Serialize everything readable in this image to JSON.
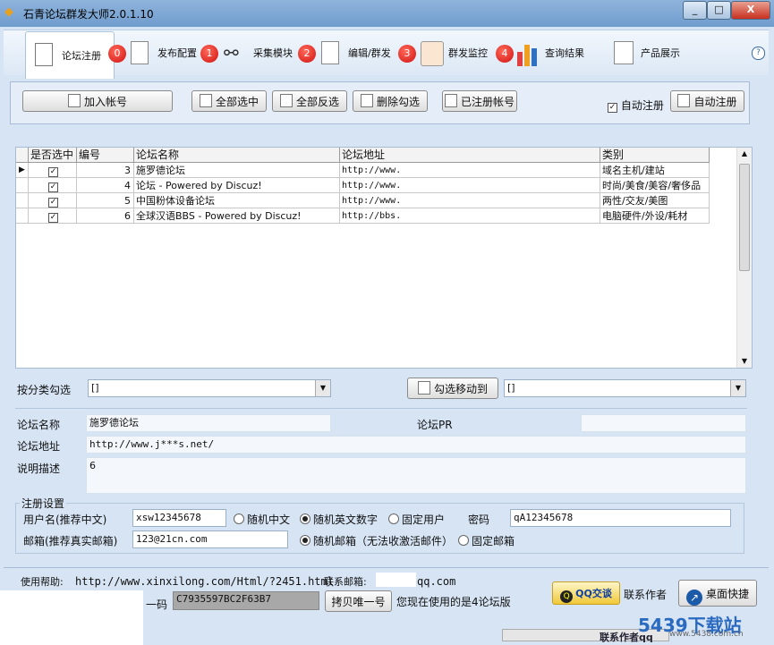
{
  "window": {
    "title": "石青论坛群发大师2.0.1.10",
    "min": "_",
    "max": "□",
    "close": "X"
  },
  "ribbon": {
    "tabs": [
      {
        "label": "论坛注册"
      },
      {
        "label": "发布配置",
        "badge": "0"
      },
      {
        "label": "采集模块",
        "badge": "1"
      },
      {
        "label": "编辑/群发",
        "badge": "2"
      },
      {
        "label": "群发监控",
        "badge": "3"
      },
      {
        "label": "查询结果",
        "badge": "4"
      },
      {
        "label": "产品展示"
      }
    ],
    "help": "?"
  },
  "toolbar": {
    "add_account": "加入帐号",
    "select_all": "全部选中",
    "invert": "全部反选",
    "delete_checked": "删除勾选",
    "registered": "已注册帐号",
    "auto_register_check": "自动注册",
    "auto_register_btn": "自动注册"
  },
  "grid": {
    "columns": [
      "是否选中",
      "编号",
      "论坛名称",
      "论坛地址",
      "类别"
    ],
    "rows": [
      {
        "num": "3",
        "name": "施罗德论坛",
        "url": "http://www.",
        "cat": "域名主机/建站"
      },
      {
        "num": "4",
        "name": "论坛 -  Powered by Discuz!",
        "url": "http://www.",
        "cat": "时尚/美食/美容/奢侈品"
      },
      {
        "num": "5",
        "name": "中国粉体设备论坛",
        "url": "http://www.",
        "cat": "两性/交友/美图"
      },
      {
        "num": "6",
        "name": " 全球汉语BBS  - Powered by Discuz!",
        "url": "http://bbs.",
        "cat": "电脑硬件/外设/耗材"
      }
    ]
  },
  "filter": {
    "label": "按分类勾选",
    "value": "[]",
    "move_btn": "勾选移动到",
    "move_value": "[]"
  },
  "detail": {
    "name_label": "论坛名称",
    "name": "施罗德论坛",
    "pr_label": "论坛PR",
    "pr": "",
    "url_label": "论坛地址",
    "url": "http://www.j***s.net/",
    "desc_label": "说明描述",
    "desc": "6"
  },
  "reg": {
    "legend": "注册设置",
    "user_label": "用户名(推荐中文)",
    "user": "xsw12345678",
    "opt_random_cn": "随机中文",
    "opt_random_en": "随机英文数字",
    "opt_fixed_user": "固定用户",
    "pwd_label": "密码",
    "pwd": "qA12345678",
    "email_label": "邮箱(推荐真实邮箱)",
    "email": "123@21cn.com",
    "opt_random_mail": "随机邮箱（无法收激活邮件）",
    "opt_fixed_mail": "固定邮箱"
  },
  "footer": {
    "help_label": "使用帮助:",
    "help_url": "http://www.xinxilong.com/Html/?2451.html",
    "mail_label": "联系邮箱:",
    "mail_suffix": "qq.com",
    "code_label": "一码",
    "code": "C7935597BC2F63B7",
    "copy_btn": "拷贝唯一号",
    "version_text": "您现在使用的是4论坛版",
    "qq_btn": "QQ交谈",
    "contact": "联系作者",
    "desktop_btn": "桌面快捷",
    "contact_bottom": "联系作者qq"
  },
  "watermark": {
    "text": "5439下载站",
    "url": "www.5438.com.cn"
  },
  "colors": {
    "accent": "#6f9ccd",
    "badge": "#d01010",
    "panel": "#e4edf8"
  }
}
